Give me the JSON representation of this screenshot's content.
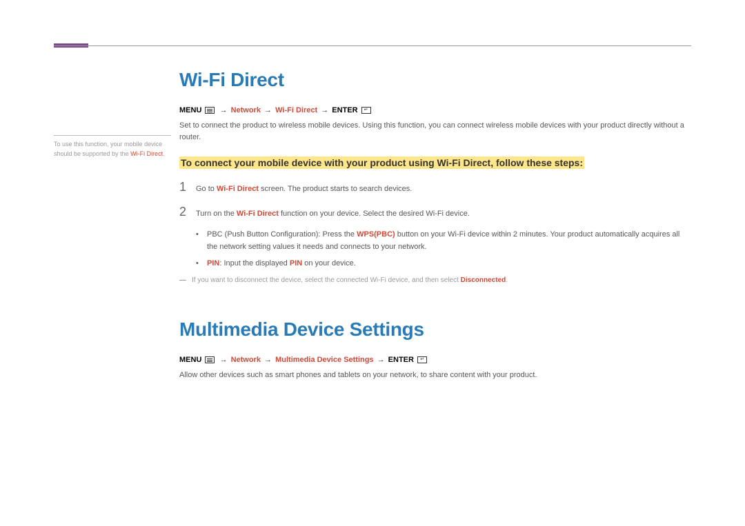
{
  "sidebar": {
    "text_before": "To use this function, your mobile device should be supported by the ",
    "red_term": "Wi-Fi Direct",
    "text_after": "."
  },
  "section1": {
    "title": "Wi-Fi Direct",
    "menu_label": "MENU",
    "path_network": "Network",
    "path_item": "Wi-Fi Direct",
    "enter_label": "ENTER",
    "description": "Set to connect the product to wireless mobile devices. Using this function, you can connect wireless mobile devices with your product directly without a router.",
    "highlight": "To connect your mobile device with your product using Wi-Fi Direct, follow these steps:",
    "step1_num": "1",
    "step1_prefix": "Go to ",
    "step1_red": "Wi-Fi Direct",
    "step1_suffix": " screen. The product starts to search devices.",
    "step2_num": "2",
    "step2_prefix": "Turn on the ",
    "step2_red": "Wi-Fi Direct",
    "step2_suffix": " function on your device. Select the desired Wi-Fi device.",
    "bullet1_prefix": "PBC (Push Button Configuration): Press the ",
    "bullet1_red": "WPS(PBC)",
    "bullet1_suffix": " button on your Wi-Fi device within 2 minutes. Your product automatically acquires all the network setting values it needs and connects to your network.",
    "bullet2_red1": "PIN",
    "bullet2_mid": ": Input the displayed ",
    "bullet2_red2": "PIN",
    "bullet2_suffix": " on your device.",
    "note_prefix": "If you want to disconnect the device, select the connected Wi-Fi device, and then select ",
    "note_red": "Disconnected",
    "note_suffix": "."
  },
  "section2": {
    "title": "Multimedia Device Settings",
    "menu_label": "MENU",
    "path_network": "Network",
    "path_item": "Multimedia Device Settings",
    "enter_label": "ENTER",
    "description": "Allow other devices such as smart phones and tablets on your network, to share content with your product."
  }
}
